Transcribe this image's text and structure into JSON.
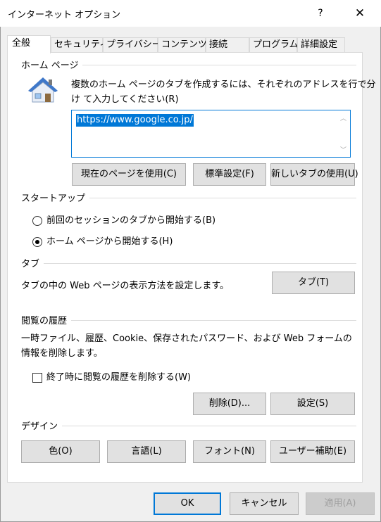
{
  "window": {
    "title": "インターネット オプション",
    "help": "?",
    "close": "✕"
  },
  "tabs": [
    {
      "label": "全般",
      "active": true
    },
    {
      "label": "セキュリティ"
    },
    {
      "label": "プライバシー"
    },
    {
      "label": "コンテンツ"
    },
    {
      "label": "接続"
    },
    {
      "label": "プログラム"
    },
    {
      "label": "詳細設定"
    }
  ],
  "home": {
    "group_title": "ホーム ページ",
    "description_line1": "複数のホーム ページのタブを作成するには、それぞれのアドレスを行で分",
    "description_line2": "け て入力してください(R)",
    "url": "https://www.google.co.jp/",
    "btn_current": "現在のページを使用(C)",
    "btn_default": "標準設定(F)",
    "btn_newtab": "新しいタブの使用(U)"
  },
  "startup": {
    "group_title": "スタートアップ",
    "option_tabs": "前回のセッションのタブから開始する(B)",
    "option_home": "ホーム ページから開始する(H)",
    "selected": "home"
  },
  "tabsgroup": {
    "group_title": "タブ",
    "description": "タブの中の Web ページの表示方法を設定します。",
    "button": "タブ(T)"
  },
  "history": {
    "group_title": "閲覧の履歴",
    "description_line1": "一時ファイル、履歴、Cookie、保存されたパスワード、および Web フォームの",
    "description_line2": "情報を削除します。",
    "checkbox_label": "終了時に閲覧の履歴を削除する(W)",
    "checked": false,
    "btn_delete": "削除(D)...",
    "btn_settings": "設定(S)"
  },
  "design": {
    "group_title": "デザイン",
    "btn_colors": "色(O)",
    "btn_languages": "言語(L)",
    "btn_fonts": "フォント(N)",
    "btn_accessibility": "ユーザー補助(E)"
  },
  "footer": {
    "ok": "OK",
    "cancel": "キャンセル",
    "apply": "適用(A)"
  }
}
